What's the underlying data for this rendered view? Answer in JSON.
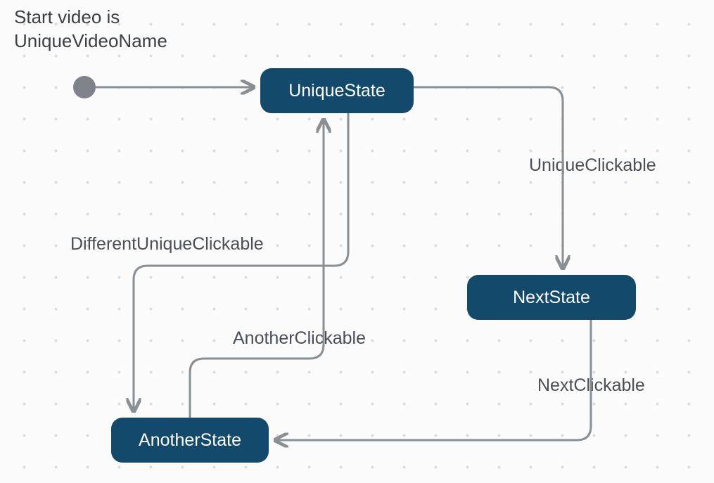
{
  "title": {
    "line1": "Start video is",
    "line2": "UniqueVideoName"
  },
  "states": {
    "unique": "UniqueState",
    "next": "NextState",
    "another": "AnotherState"
  },
  "edges": {
    "uniqueClickable": "UniqueClickable",
    "nextClickable": "NextClickable",
    "anotherClickable": "AnotherClickable",
    "differentUniqueClickable": "DifferentUniqueClickable"
  },
  "colors": {
    "stateFill": "#13496b",
    "arrow": "#8a8f94",
    "startDot": "#7f8389",
    "bg": "#fbfbfb"
  }
}
